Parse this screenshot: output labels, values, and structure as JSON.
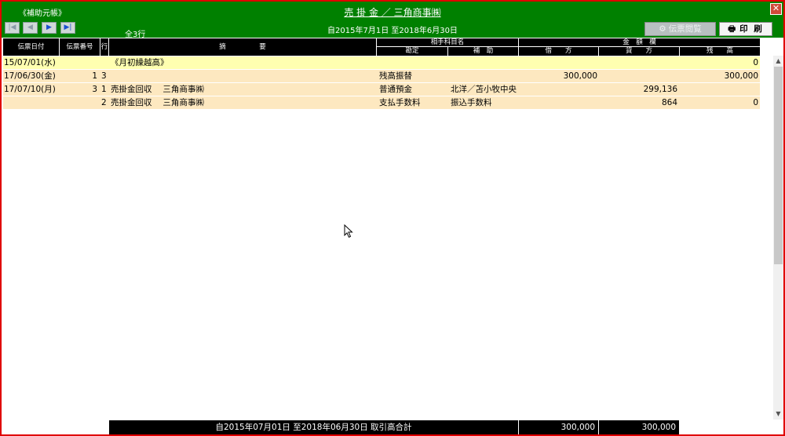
{
  "header": {
    "app_name": "《補助元帳》",
    "title": "売 掛 金 ／ 三角商事㈱",
    "period": "自2015年7月1日  至2018年6月30日",
    "row_count": "全3行",
    "nav": {
      "first": "|◀",
      "prev": "◀",
      "next": "▶",
      "last": "▶|"
    },
    "voucher_button": "伝票閲覧",
    "print_button": "印 刷",
    "close_glyph": "✕",
    "colors": {
      "header_bg": "#008000",
      "frame_border": "#e00000"
    }
  },
  "columns": {
    "date": "伝票日付",
    "voucher_no": "伝票番号",
    "line": "行",
    "description": "摘　　　　　要",
    "counter_group": "相手科目名",
    "counter_account": "勘定",
    "counter_sub": "補　助",
    "amount_group": "金　額　欄",
    "debit": "借　　方",
    "credit": "貸　　方",
    "balance": "残　　高"
  },
  "rows": [
    {
      "date": "15/07/01(水)",
      "voucher": "",
      "line": "",
      "desc": "《月初繰越高》",
      "account": "",
      "sub": "",
      "debit": "",
      "credit": "",
      "balance": "0",
      "bg": "#ffffb0"
    },
    {
      "date": "17/06/30(金)",
      "voucher": "1",
      "line": "3",
      "desc": "",
      "account": "残高振替",
      "sub": "",
      "debit": "300,000",
      "credit": "",
      "balance": "300,000",
      "bg": "#fde8c0"
    },
    {
      "date": "17/07/10(月)",
      "voucher": "3",
      "line": "1",
      "desc": "売掛金回収　 三角商事㈱",
      "account": "普通預金",
      "sub": "北洋／苫小牧中央",
      "debit": "",
      "credit": "299,136",
      "balance": "",
      "bg": "#fde8c0"
    },
    {
      "date": "",
      "voucher": "",
      "line": "2",
      "desc": "売掛金回収　 三角商事㈱",
      "account": "支払手数料",
      "sub": "振込手数料",
      "debit": "",
      "credit": "864",
      "balance": "0",
      "bg": "#fde8c0"
    }
  ],
  "footer": {
    "label": "自2015年07月01日  至2018年06月30日  取引高合計",
    "debit_total": "300,000",
    "credit_total": "300,000"
  },
  "scrollbar": {
    "up": "▲",
    "down": "▼"
  }
}
